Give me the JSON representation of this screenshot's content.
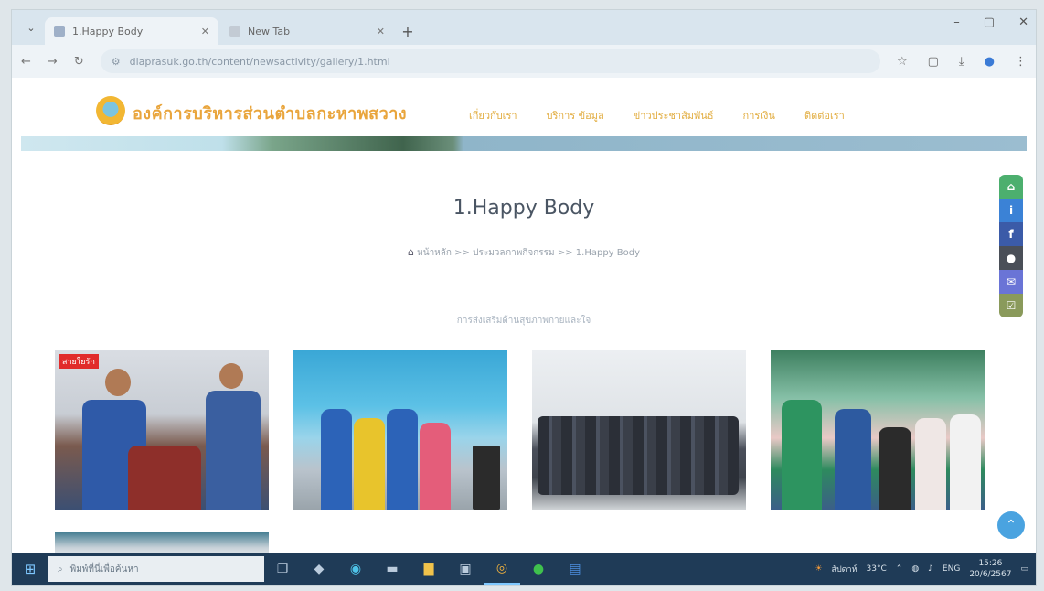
{
  "browser": {
    "tabs": [
      {
        "title": "1.Happy Body",
        "active": true
      },
      {
        "title": "New Tab",
        "active": false
      }
    ],
    "new_tab_glyph": "+",
    "window_controls": [
      "–",
      "▢",
      "✕"
    ],
    "url": "dlaprasuk.go.th/content/newsactivity/gallery/1.html",
    "toolbar_icons": [
      "star-icon",
      "extensions-icon",
      "download-icon",
      "profile-icon",
      "menu-icon"
    ]
  },
  "site": {
    "name": "องค์การบริหารส่วนตำบลกะหาพสวาง",
    "nav": [
      "เกี่ยวกับเรา",
      "บริการ ข้อมูล",
      "ข่าวประชาสัมพันธ์",
      "การเงิน",
      "ติดต่อเรา"
    ]
  },
  "page": {
    "title": "1.Happy Body",
    "breadcrumb": {
      "home": "หน้าหลัก",
      "sep1": ">>",
      "middle": "ประมวลภาพกิจกรรม",
      "sep2": ">>",
      "current": "1.Happy Body"
    },
    "section_subtitle": "การส่งเสริมด้านสุขภาพกายและใจ",
    "photo_tag": "สายใยรัก"
  },
  "side_rail": [
    {
      "icon": "home-icon",
      "glyph": "⌂",
      "color": "#4caf6e"
    },
    {
      "icon": "info-icon",
      "glyph": "i",
      "color": "#3b82d6"
    },
    {
      "icon": "facebook-icon",
      "glyph": "f",
      "color": "#3b5ba8"
    },
    {
      "icon": "user-icon",
      "glyph": "●",
      "color": "#4a4f58"
    },
    {
      "icon": "mail-icon",
      "glyph": "✉",
      "color": "#6a74d6"
    },
    {
      "icon": "checklist-icon",
      "glyph": "☑",
      "color": "#8a9a5b"
    }
  ],
  "taskbar": {
    "search_placeholder": "พิมพ์ที่นี่เพื่อค้นหา",
    "weather": "สัปดาห์",
    "weather_temp": "33°C",
    "language": "ENG",
    "time": "15:26",
    "date": "20/6/2567"
  }
}
